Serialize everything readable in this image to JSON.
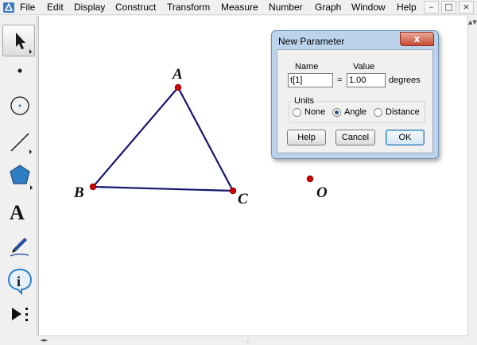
{
  "menu": {
    "items": [
      "File",
      "Edit",
      "Display",
      "Construct",
      "Transform",
      "Measure",
      "Number",
      "Graph",
      "Window",
      "Help"
    ]
  },
  "window_controls": [
    "–",
    "□",
    "×"
  ],
  "toolbox": {
    "tools": [
      {
        "id": "arrow",
        "icon": "selection-arrow-icon"
      },
      {
        "id": "point",
        "icon": "point-icon"
      },
      {
        "id": "compass",
        "icon": "compass-icon"
      },
      {
        "id": "straightedge",
        "icon": "straightedge-icon"
      },
      {
        "id": "polygon",
        "icon": "polygon-icon"
      },
      {
        "id": "text",
        "icon": "text-icon",
        "label": "A"
      },
      {
        "id": "marker",
        "icon": "marker-icon"
      },
      {
        "id": "information",
        "icon": "information-icon",
        "label": "i"
      },
      {
        "id": "custom",
        "icon": "custom-tool-icon"
      }
    ]
  },
  "canvas": {
    "points": [
      {
        "label": "A"
      },
      {
        "label": "B"
      },
      {
        "label": "C"
      },
      {
        "label": "O"
      }
    ],
    "colors": {
      "segment": "#15166e",
      "point": "#d00000"
    }
  },
  "dialog": {
    "title": "New Parameter",
    "close": "x",
    "name_label": "Name",
    "value_label": "Value",
    "name_value": "t[1]",
    "equals": "=",
    "value_value": "1.00",
    "unit_suffix": "degrees",
    "units_label": "Units",
    "units_options": [
      "None",
      "Angle",
      "Distance"
    ],
    "units_selected": "Angle",
    "buttons": {
      "help": "Help",
      "cancel": "Cancel",
      "ok": "OK"
    }
  },
  "scrollbars": {
    "vertical": "▲▼",
    "horizontal": "◄►",
    "grip": "⦙"
  }
}
